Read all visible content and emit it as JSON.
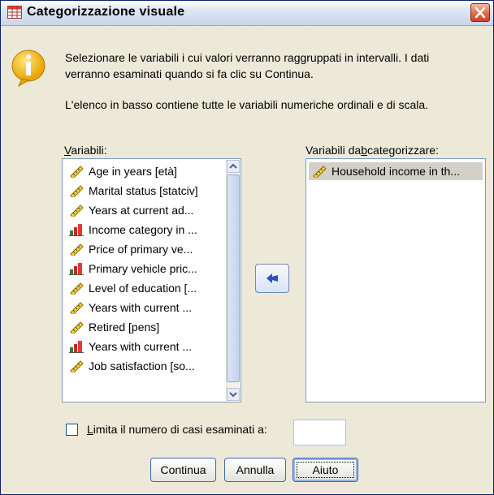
{
  "window": {
    "title": "Categorizzazione visuale",
    "app_icon": "grid-table-icon",
    "close_icon": "close-icon"
  },
  "info": {
    "icon": "info-icon",
    "line1": "Selezionare le variabili i cui valori verranno raggruppati in intervalli. I dati",
    "line2": "verranno esaminati quando si fa clic su Continua.",
    "line3": "L'elenco in basso contiene tutte le variabili numeriche ordinali e di scala."
  },
  "variables_label": "Variabili:",
  "variables": [
    {
      "label": "Age in years [età]",
      "icon": "scale-ruler-icon"
    },
    {
      "label": "Marital status [statciv]",
      "icon": "scale-ruler-icon"
    },
    {
      "label": "Years at current ad...",
      "icon": "scale-ruler-icon"
    },
    {
      "label": "Income category in ...",
      "icon": "ordinal-bars-icon"
    },
    {
      "label": "Price of primary ve...",
      "icon": "scale-ruler-icon"
    },
    {
      "label": "Primary vehicle pric...",
      "icon": "ordinal-bars-icon"
    },
    {
      "label": "Level of education [...",
      "icon": "scale-ruler-icon"
    },
    {
      "label": "Years with current ...",
      "icon": "scale-ruler-icon"
    },
    {
      "label": "Retired [pens]",
      "icon": "scale-ruler-icon"
    },
    {
      "label": "Years with current ...",
      "icon": "ordinal-bars-icon"
    },
    {
      "label": "Job satisfaction [so...",
      "icon": "scale-ruler-icon"
    }
  ],
  "target_label": "Variabili da categorizzare:",
  "target_variables": [
    {
      "label": "Household income in th...",
      "icon": "scale-ruler-icon"
    }
  ],
  "move_button_icon": "arrow-left-icon",
  "limit": {
    "label": "Limita il numero di casi esaminati a:",
    "checked": false,
    "value": ""
  },
  "buttons": {
    "continue": "Continua",
    "cancel": "Annulla",
    "help": "Aiuto"
  }
}
